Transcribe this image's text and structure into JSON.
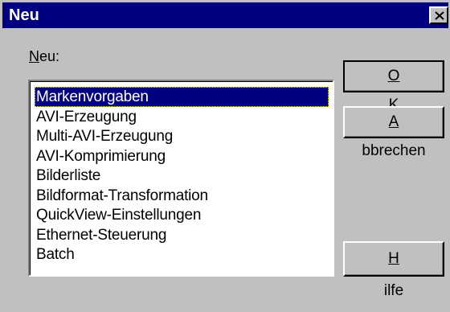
{
  "window": {
    "title": "Neu",
    "close_icon": "close-icon"
  },
  "list": {
    "label_accel": "N",
    "label_rest": "eu:",
    "items": [
      "Markenvorgaben",
      "AVI-Erzeugung",
      "Multi-AVI-Erzeugung",
      "AVI-Komprimierung",
      "Bilderliste",
      "Bildformat-Transformation",
      "QuickView-Einstellungen",
      "Ethernet-Steuerung",
      "Batch"
    ],
    "selected": "Markenvorgaben"
  },
  "buttons": {
    "ok_accel": "O",
    "ok_rest": "K",
    "cancel_accel": "A",
    "cancel_rest": "bbrechen",
    "help_accel": "H",
    "help_rest": "ilfe"
  },
  "colors": {
    "titlebar": "#000080",
    "face": "#c0c0c0",
    "selection": "#000080"
  }
}
